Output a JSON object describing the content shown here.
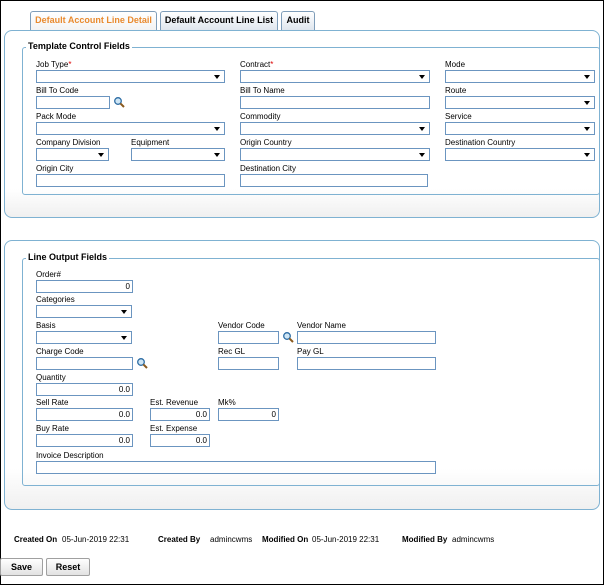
{
  "tabs": [
    "Default Account Line Detail",
    "Default Account Line List",
    "Audit"
  ],
  "template": {
    "legend": "Template Control Fields",
    "job_type": "Job Type",
    "contract": "Contract",
    "mode": "Mode",
    "bill_to_code": "Bill To Code",
    "bill_to_name": "Bill To Name",
    "route": "Route",
    "pack_mode": "Pack Mode",
    "commodity": "Commodity",
    "service": "Service",
    "company_division": "Company Division",
    "equipment": "Equipment",
    "origin_country": "Origin Country",
    "destination_country": "Destination Country",
    "origin_city": "Origin City",
    "destination_city": "Destination City",
    "required_mark": "*"
  },
  "output": {
    "legend": "Line Output Fields",
    "order": "Order#",
    "order_value": "0",
    "categories": "Categories",
    "basis": "Basis",
    "vendor_code": "Vendor Code",
    "vendor_name": "Vendor Name",
    "charge_code": "Charge Code",
    "rec_gl": "Rec GL",
    "pay_gl": "Pay GL",
    "quantity": "Quantity",
    "quantity_value": "0.0",
    "sell_rate": "Sell Rate",
    "sell_rate_value": "0.0",
    "est_revenue": "Est. Revenue",
    "est_revenue_value": "0.0",
    "mk_pct": "Mk%",
    "mk_pct_value": "0",
    "buy_rate": "Buy Rate",
    "buy_rate_value": "0.0",
    "est_expense": "Est. Expense",
    "est_expense_value": "0.0",
    "invoice_description": "Invoice Description"
  },
  "footer": {
    "created_on_label": "Created On",
    "created_on": "05-Jun-2019 22:31",
    "created_by_label": "Created By",
    "created_by": "admincwms",
    "modified_on_label": "Modified On",
    "modified_on": "05-Jun-2019 22:31",
    "modified_by_label": "Modified By",
    "modified_by": "admincwms"
  },
  "buttons": {
    "save": "Save",
    "reset": "Reset"
  },
  "icons": {
    "lookup": "magnifier-icon"
  },
  "colors": {
    "active_tab": "#e98a2e",
    "border": "#7fb2d2",
    "required": "#dd0000"
  }
}
